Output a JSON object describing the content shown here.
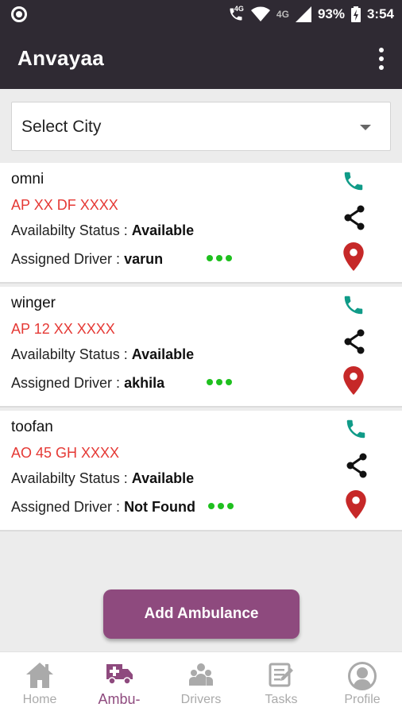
{
  "status_bar": {
    "battery": "93%",
    "time": "3:54",
    "network_small": "4G",
    "network_big": "4G"
  },
  "app_bar": {
    "title": "Anvayaa"
  },
  "city_select": {
    "label": "Select City"
  },
  "vehicles": [
    {
      "name": "omni",
      "plate": "AP XX DF XXXX",
      "status_label": "Availabilty Status : ",
      "status": "Available",
      "driver_label": "Assigned Driver : ",
      "driver": "varun"
    },
    {
      "name": "winger",
      "plate": "AP 12 XX XXXX",
      "status_label": "Availabilty Status : ",
      "status": "Available",
      "driver_label": "Assigned Driver : ",
      "driver": "akhila"
    },
    {
      "name": "toofan",
      "plate": "AO 45 GH XXXX",
      "status_label": "Availabilty Status : ",
      "status": "Available",
      "driver_label": "Assigned Driver : ",
      "driver": "Not Found"
    }
  ],
  "add_button": {
    "label": "Add Ambulance"
  },
  "bottom_nav": [
    {
      "label": "Home",
      "icon": "home-icon",
      "active": false
    },
    {
      "label": "Ambu-",
      "icon": "ambulance-icon",
      "active": true
    },
    {
      "label": "Drivers",
      "icon": "drivers-icon",
      "active": false
    },
    {
      "label": "Tasks",
      "icon": "tasks-icon",
      "active": false
    },
    {
      "label": "Profile",
      "icon": "profile-icon",
      "active": false
    }
  ],
  "colors": {
    "bar": "#2f2a33",
    "accent": "#8e4a7e",
    "plate": "#e53935",
    "phone": "#109b88",
    "pin": "#c62828",
    "dots": "#1fc01f"
  }
}
